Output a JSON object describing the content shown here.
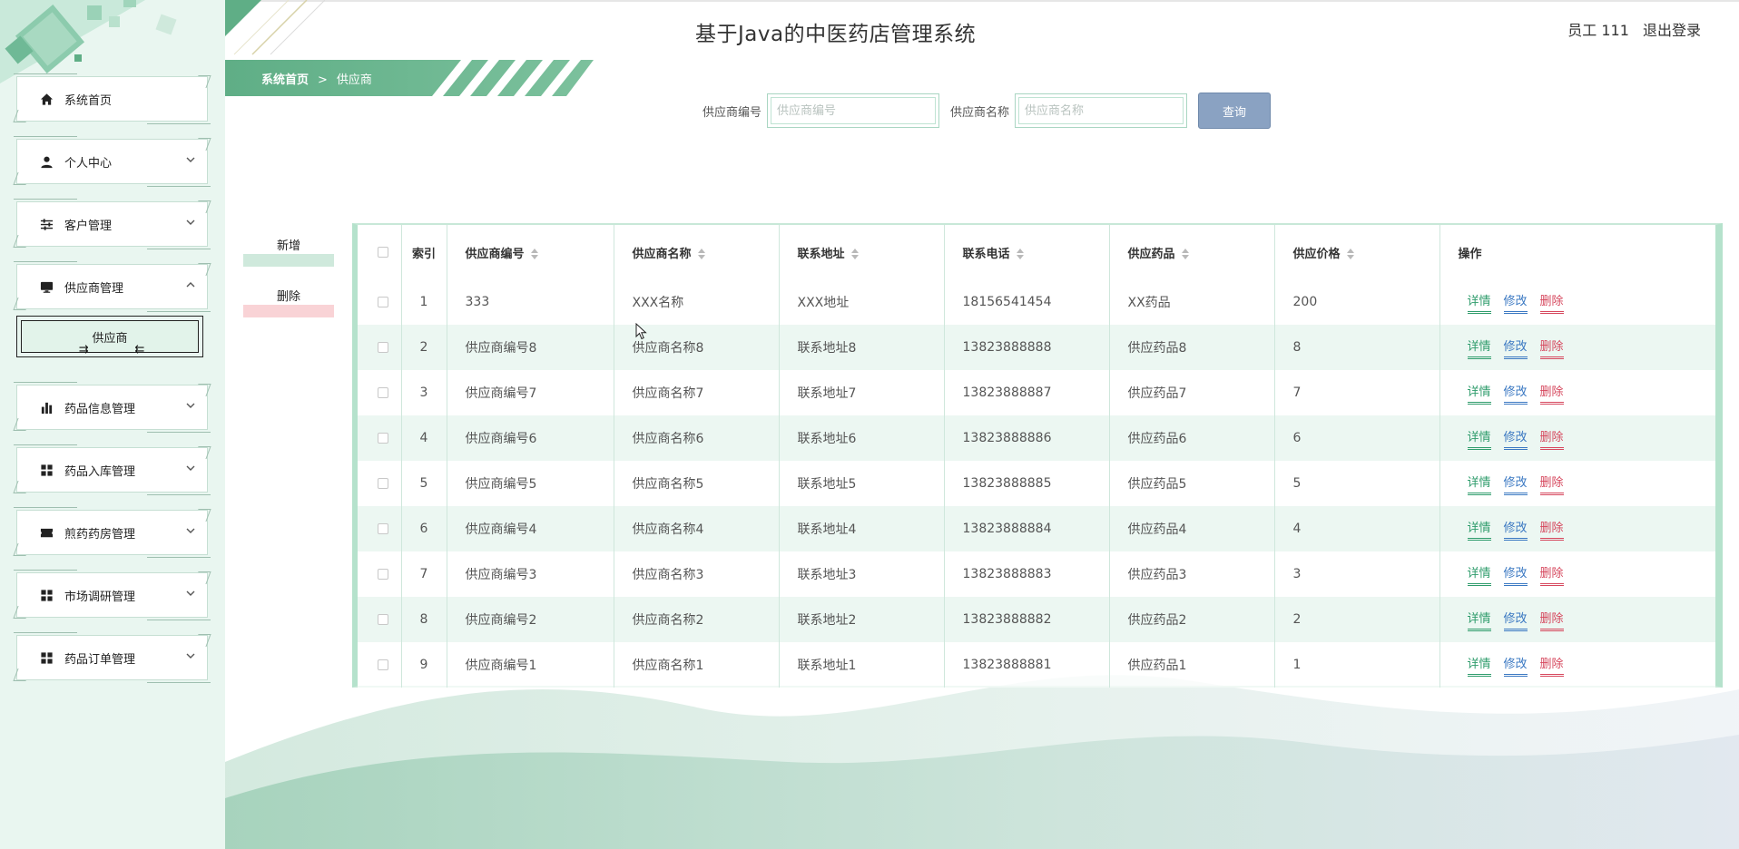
{
  "app": {
    "title": "基于Java的中医药店管理系统",
    "user_label": "员工 111",
    "logout": "退出登录"
  },
  "breadcrumb": {
    "home": "系统首页",
    "separator": ">",
    "current": "供应商"
  },
  "sidebar": {
    "items": [
      {
        "label": "系统首页",
        "icon": "home-icon"
      },
      {
        "label": "个人中心",
        "icon": "user-icon"
      },
      {
        "label": "客户管理",
        "icon": "sliders-icon"
      },
      {
        "label": "供应商管理",
        "icon": "monitor-icon",
        "expanded": true
      },
      {
        "label": "药品信息管理",
        "icon": "bar-chart-icon"
      },
      {
        "label": "药品入库管理",
        "icon": "grid-icon"
      },
      {
        "label": "煎药药房管理",
        "icon": "ticket-icon"
      },
      {
        "label": "市场调研管理",
        "icon": "grid-icon"
      },
      {
        "label": "药品订单管理",
        "icon": "grid-icon"
      }
    ],
    "sub_item": "供应商"
  },
  "search": {
    "code_label": "供应商编号",
    "code_placeholder": "供应商编号",
    "code_value": "",
    "name_label": "供应商名称",
    "name_placeholder": "供应商名称",
    "name_value": "",
    "query_button": "查询"
  },
  "actions": {
    "add": "新增",
    "delete": "删除"
  },
  "table": {
    "headers": {
      "index": "索引",
      "code": "供应商编号",
      "name": "供应商名称",
      "address": "联系地址",
      "phone": "联系电话",
      "drug": "供应药品",
      "price": "供应价格",
      "ops": "操作"
    },
    "op_labels": {
      "detail": "详情",
      "edit": "修改",
      "delete": "删除"
    },
    "rows": [
      {
        "index": "1",
        "code": "333",
        "name": "XXX名称",
        "address": "XXX地址",
        "phone": "18156541454",
        "drug": "XX药品",
        "price": "200"
      },
      {
        "index": "2",
        "code": "供应商编号8",
        "name": "供应商名称8",
        "address": "联系地址8",
        "phone": "13823888888",
        "drug": "供应药品8",
        "price": "8"
      },
      {
        "index": "3",
        "code": "供应商编号7",
        "name": "供应商名称7",
        "address": "联系地址7",
        "phone": "13823888887",
        "drug": "供应药品7",
        "price": "7"
      },
      {
        "index": "4",
        "code": "供应商编号6",
        "name": "供应商名称6",
        "address": "联系地址6",
        "phone": "13823888886",
        "drug": "供应药品6",
        "price": "6"
      },
      {
        "index": "5",
        "code": "供应商编号5",
        "name": "供应商名称5",
        "address": "联系地址5",
        "phone": "13823888885",
        "drug": "供应药品5",
        "price": "5"
      },
      {
        "index": "6",
        "code": "供应商编号4",
        "name": "供应商名称4",
        "address": "联系地址4",
        "phone": "13823888884",
        "drug": "供应药品4",
        "price": "4"
      },
      {
        "index": "7",
        "code": "供应商编号3",
        "name": "供应商名称3",
        "address": "联系地址3",
        "phone": "13823888883",
        "drug": "供应药品3",
        "price": "3"
      },
      {
        "index": "8",
        "code": "供应商编号2",
        "name": "供应商名称2",
        "address": "联系地址2",
        "phone": "13823888882",
        "drug": "供应药品2",
        "price": "2"
      },
      {
        "index": "9",
        "code": "供应商编号1",
        "name": "供应商名称1",
        "address": "联系地址1",
        "phone": "13823888881",
        "drug": "供应药品1",
        "price": "1"
      }
    ]
  },
  "colors": {
    "brand_green": "#5fae86",
    "sidebar_bg": "#e9f6f0",
    "detail_link": "#2f9c6c",
    "edit_link": "#3a78c2",
    "delete_link": "#d6475d",
    "query_button": "#8aa2c2"
  }
}
